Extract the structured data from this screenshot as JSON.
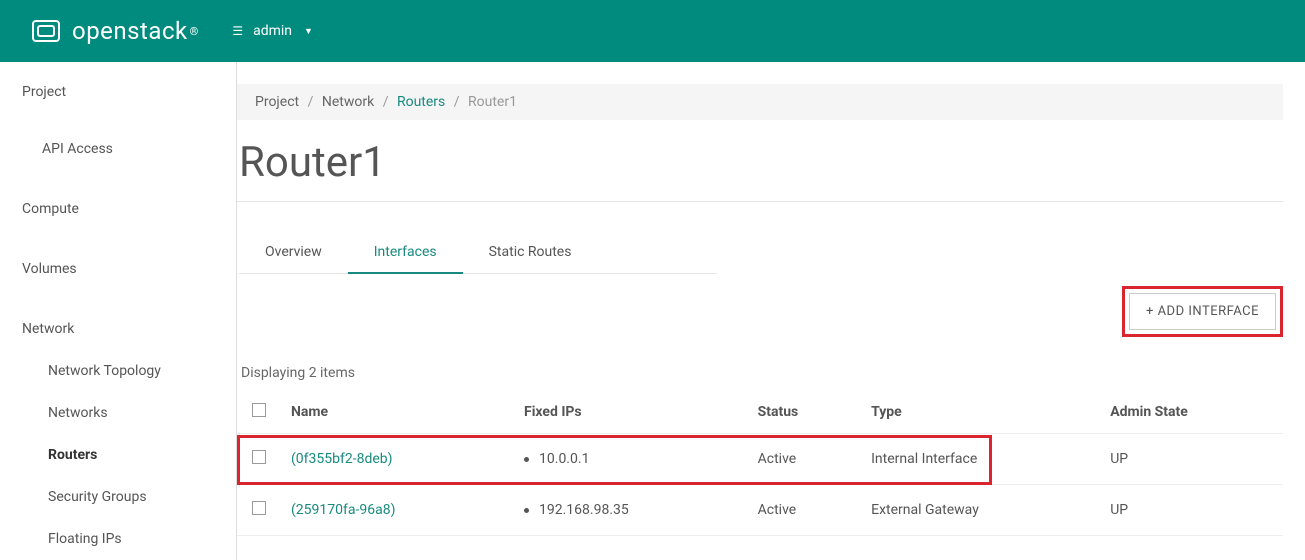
{
  "logo_text": "openstack",
  "top_project": "admin",
  "sidebar": {
    "sections": [
      {
        "label": "Project"
      }
    ],
    "items": [
      {
        "label": "API Access",
        "nested": false,
        "active": false
      },
      {
        "label": "Compute",
        "nested": false,
        "active": false
      },
      {
        "label": "Volumes",
        "nested": false,
        "active": false
      },
      {
        "label": "Network",
        "nested": false,
        "active": false
      },
      {
        "label": "Network Topology",
        "nested": true,
        "active": false
      },
      {
        "label": "Networks",
        "nested": true,
        "active": false
      },
      {
        "label": "Routers",
        "nested": true,
        "active": true
      },
      {
        "label": "Security Groups",
        "nested": true,
        "active": false
      },
      {
        "label": "Floating IPs",
        "nested": true,
        "active": false
      }
    ]
  },
  "breadcrumb": {
    "parts": [
      "Project",
      "Network",
      "Routers",
      "Router1"
    ],
    "link_index": 2
  },
  "page_title": "Router1",
  "tabs": [
    {
      "label": "Overview",
      "active": false
    },
    {
      "label": "Interfaces",
      "active": true
    },
    {
      "label": "Static Routes",
      "active": false
    }
  ],
  "add_button": "+ ADD INTERFACE",
  "items_count": "Displaying 2 items",
  "columns": [
    "Name",
    "Fixed IPs",
    "Status",
    "Type",
    "Admin State"
  ],
  "rows": [
    {
      "name": "(0f355bf2-8deb)",
      "fixed_ip": "10.0.0.1",
      "status": "Active",
      "type": "Internal Interface",
      "admin_state": "UP",
      "highlight": true
    },
    {
      "name": "(259170fa-96a8)",
      "fixed_ip": "192.168.98.35",
      "status": "Active",
      "type": "External Gateway",
      "admin_state": "UP",
      "highlight": false
    }
  ]
}
